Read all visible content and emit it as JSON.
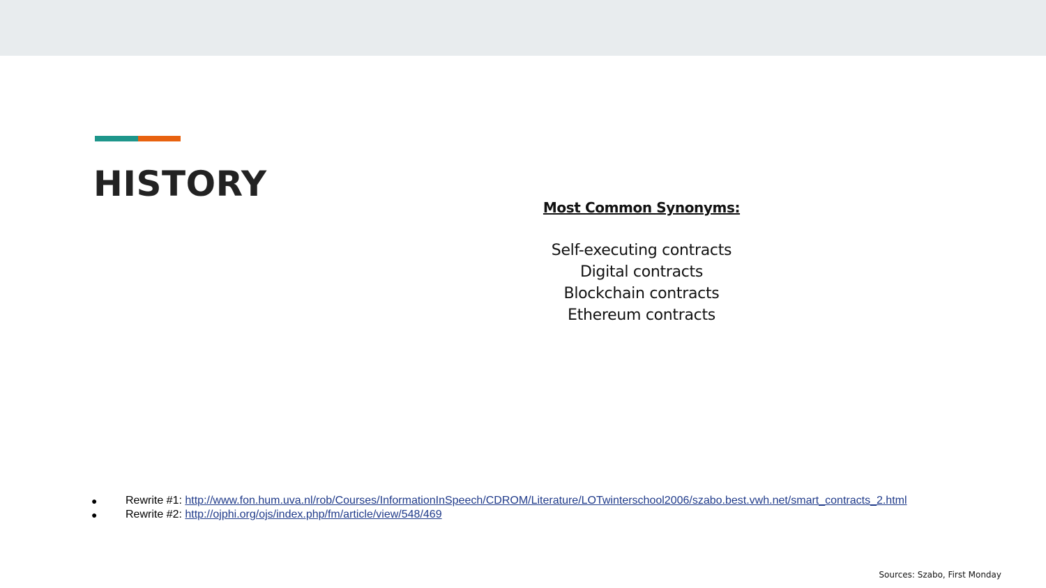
{
  "colors": {
    "accent_teal": "#1e968b",
    "accent_orange": "#e8620f",
    "link": "#1f3a8a",
    "header_band": "#e8ecee"
  },
  "slide": {
    "title": "HISTORY",
    "synonyms_heading": "Most Common Synonyms:",
    "synonyms": [
      "Self-executing contracts",
      "Digital contracts",
      "Blockchain contracts",
      "Ethereum contracts"
    ],
    "references": [
      {
        "bullet": "●",
        "label": "Rewrite #1: ",
        "url": "http://www.fon.hum.uva.nl/rob/Courses/InformationInSpeech/CDROM/Literature/LOTwinterschool2006/szabo.best.vwh.net/smart_contracts_2.html"
      },
      {
        "bullet": "●",
        "label": "Rewrite #2: ",
        "url": "http://ojphi.org/ojs/index.php/fm/article/view/548/469"
      }
    ],
    "sources": "Sources:  Szabo, First Monday"
  }
}
